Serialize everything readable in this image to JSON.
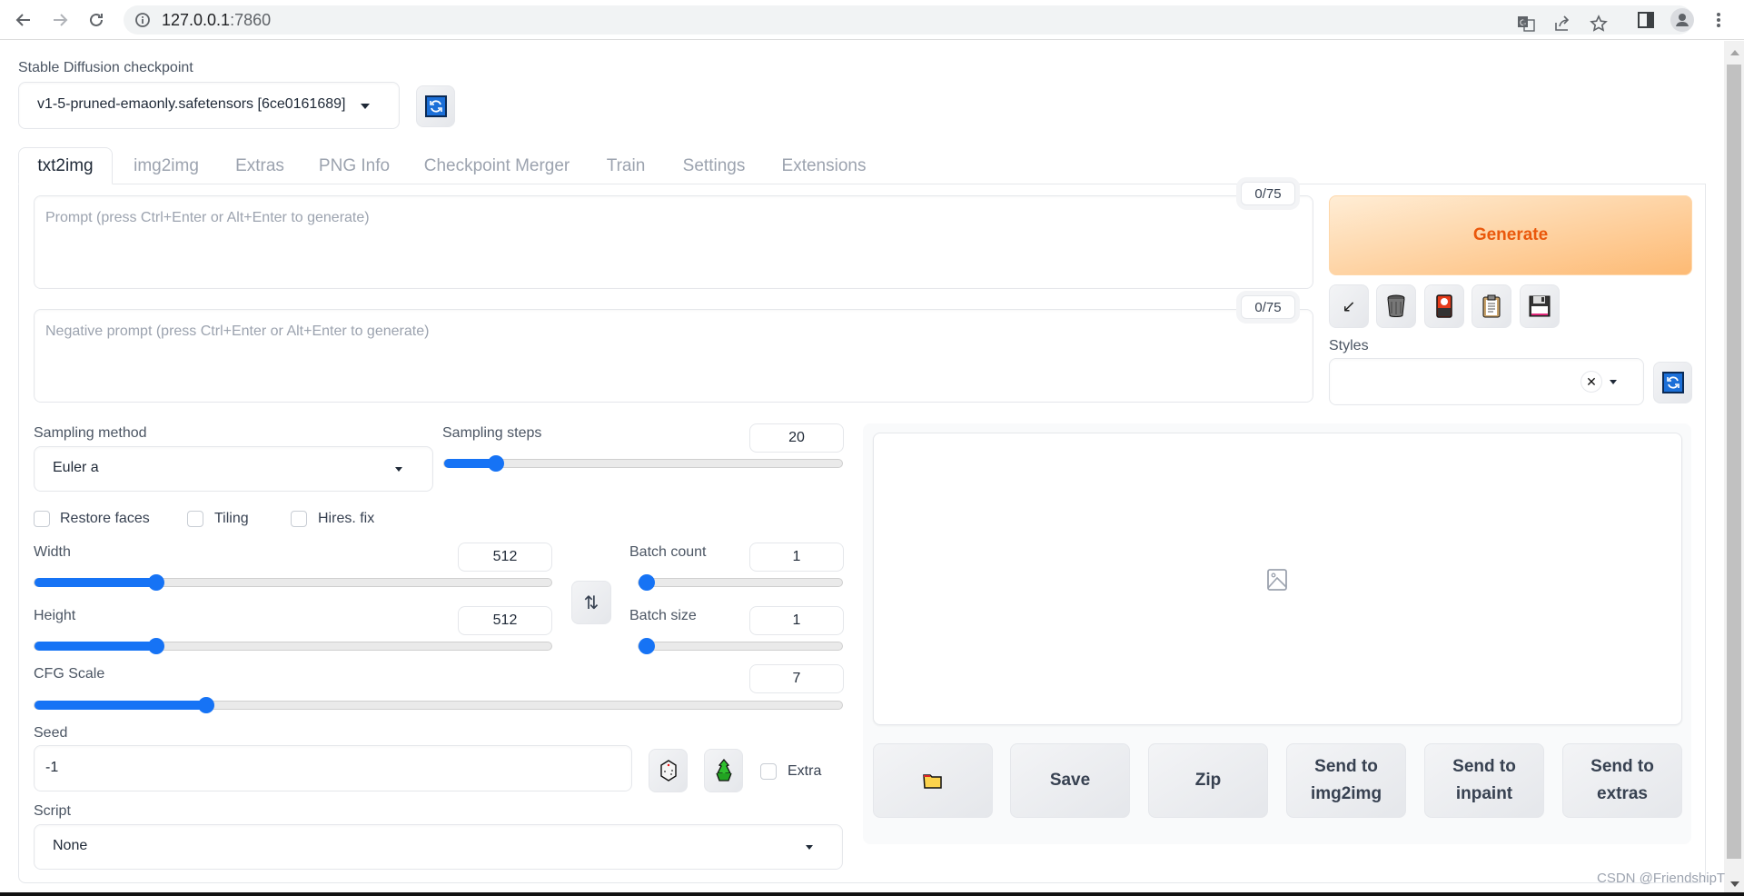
{
  "browser": {
    "url_host": "127.0.0.1",
    "url_port": ":7860",
    "icons": [
      "back-icon",
      "forward-icon",
      "reload-icon",
      "info-icon",
      "translate-icon",
      "share-icon",
      "bookmark-star-icon",
      "side-panel-icon",
      "profile-icon",
      "menu-icon"
    ]
  },
  "checkpoint": {
    "label": "Stable Diffusion checkpoint",
    "value": "v1-5-pruned-emaonly.safetensors [6ce0161689]"
  },
  "tabs": [
    {
      "label": "txt2img",
      "active": true
    },
    {
      "label": "img2img",
      "active": false
    },
    {
      "label": "Extras",
      "active": false
    },
    {
      "label": "PNG Info",
      "active": false
    },
    {
      "label": "Checkpoint Merger",
      "active": false
    },
    {
      "label": "Train",
      "active": false
    },
    {
      "label": "Settings",
      "active": false
    },
    {
      "label": "Extensions",
      "active": false
    }
  ],
  "prompt": {
    "placeholder": "Prompt (press Ctrl+Enter or Alt+Enter to generate)",
    "value": "",
    "token_counter": "0/75"
  },
  "negative_prompt": {
    "placeholder": "Negative prompt (press Ctrl+Enter or Alt+Enter to generate)",
    "value": "",
    "token_counter": "0/75"
  },
  "generate": {
    "label": "Generate",
    "color": "#ea580c"
  },
  "tool_buttons": [
    {
      "name": "read-generation-params-icon",
      "glyph": "↙"
    },
    {
      "name": "trash-icon",
      "glyph": "🗑"
    },
    {
      "name": "extra-networks-icon",
      "glyph": "🎴"
    },
    {
      "name": "clipboard-icon",
      "glyph": "📋"
    },
    {
      "name": "save-style-icon",
      "glyph": "💾"
    }
  ],
  "styles": {
    "label": "Styles",
    "value": "",
    "clear_glyph": "✕"
  },
  "sampling": {
    "method_label": "Sampling method",
    "method_value": "Euler a",
    "steps_label": "Sampling steps",
    "steps_value": "20",
    "steps_fraction": 0.13
  },
  "checkboxes": [
    {
      "label": "Restore faces",
      "checked": false
    },
    {
      "label": "Tiling",
      "checked": false
    },
    {
      "label": "Hires. fix",
      "checked": false
    }
  ],
  "dimensions": {
    "width_label": "Width",
    "width_value": "512",
    "width_fraction": 0.235,
    "height_label": "Height",
    "height_value": "512",
    "height_fraction": 0.235,
    "swap_glyph": "⇅"
  },
  "batch": {
    "count_label": "Batch count",
    "count_value": "1",
    "count_fraction": 0.0,
    "size_label": "Batch size",
    "size_value": "1",
    "size_fraction": 0.0
  },
  "cfg": {
    "label": "CFG Scale",
    "value": "7",
    "fraction": 0.2128
  },
  "seed": {
    "label": "Seed",
    "value": "-1",
    "dice_glyph": "🎲",
    "recycle_glyph": "♻",
    "extra_label": "Extra"
  },
  "script": {
    "label": "Script",
    "value": "None"
  },
  "output": {
    "buttons": [
      {
        "name": "open-folder-button",
        "label": "",
        "glyph": "📂"
      },
      {
        "name": "save-button",
        "label": "Save"
      },
      {
        "name": "zip-button",
        "label": "Zip"
      },
      {
        "name": "send-to-img2img-button",
        "label": "Send to img2img"
      },
      {
        "name": "send-to-inpaint-button",
        "label": "Send to inpaint"
      },
      {
        "name": "send-to-extras-button",
        "label": "Send to extras"
      }
    ]
  },
  "watermark": "CSDN @FriendshipT"
}
